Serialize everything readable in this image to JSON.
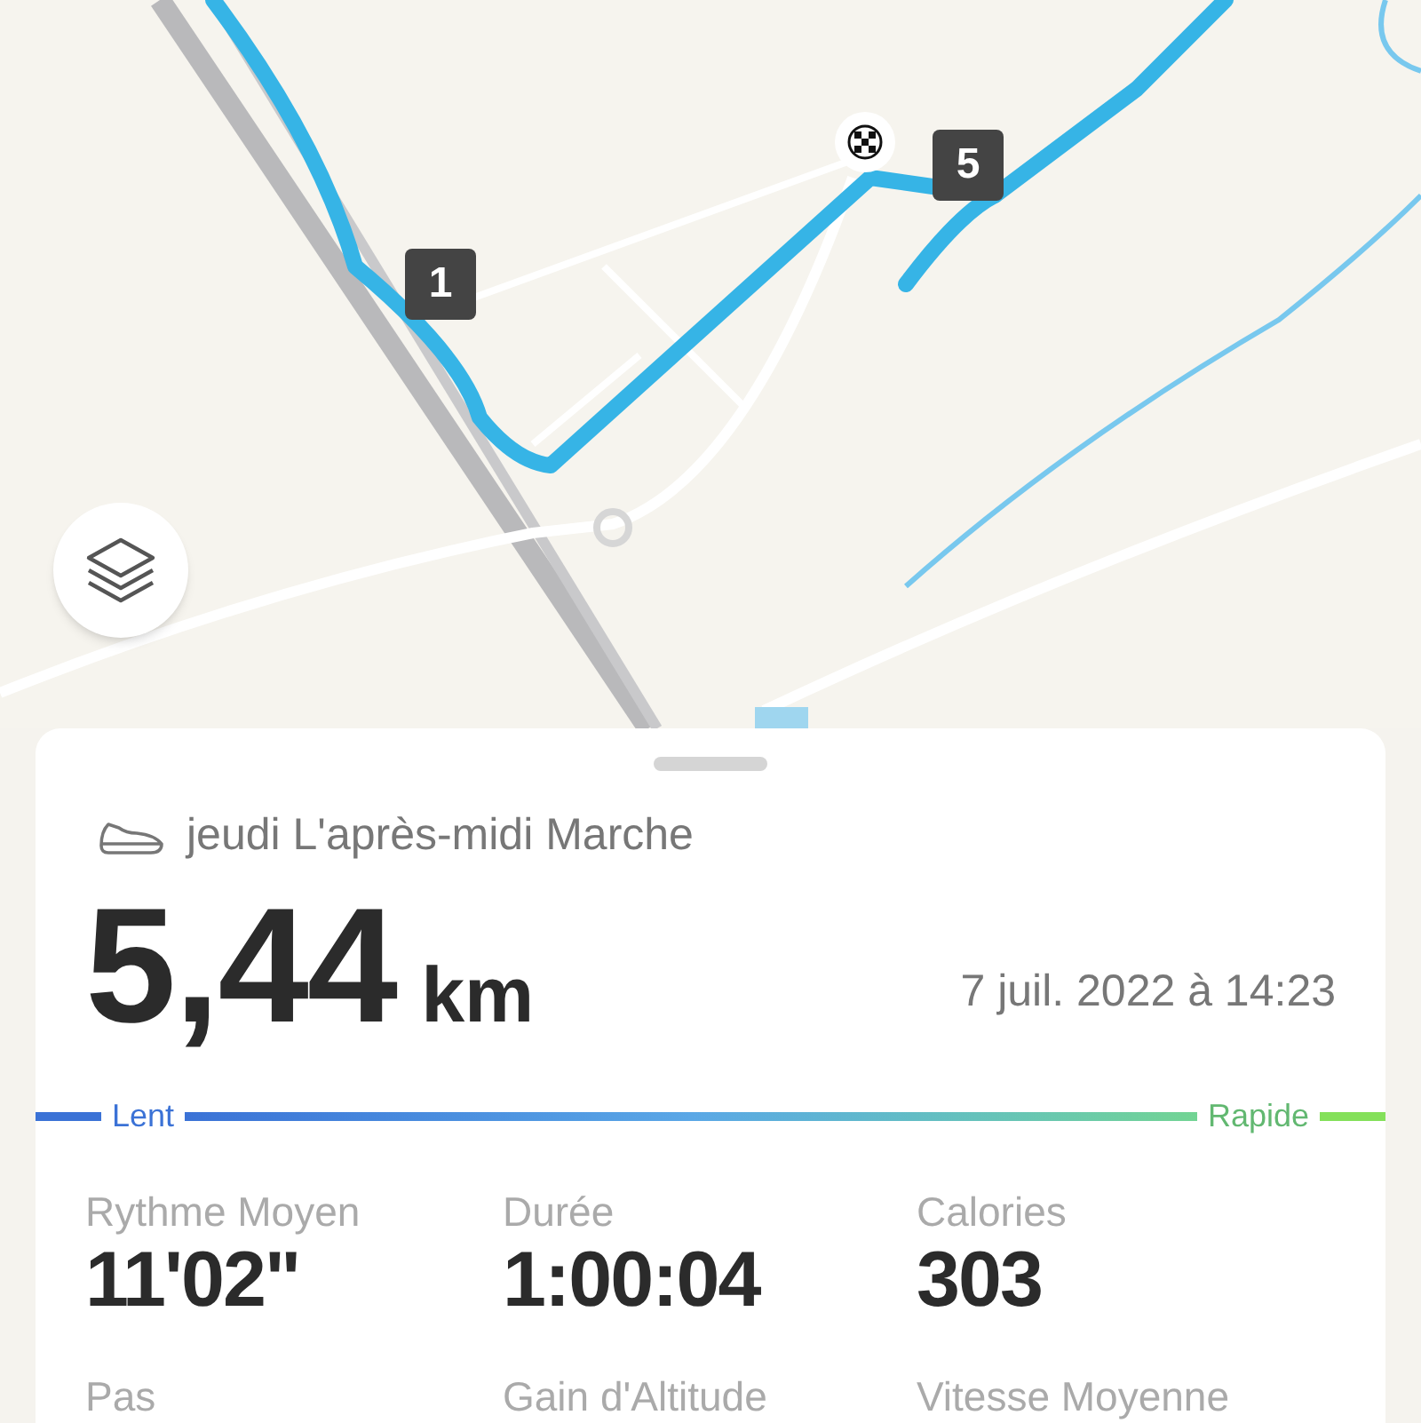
{
  "map": {
    "markers": [
      {
        "label": "1",
        "kind": "km"
      },
      {
        "label": "5",
        "kind": "km"
      },
      {
        "kind": "finish"
      }
    ]
  },
  "activity": {
    "title": "jeudi L'après-midi Marche",
    "distance": "5,44",
    "unit": "km",
    "date": "7 juil. 2022 à 14:23"
  },
  "speed_scale": {
    "slow": "Lent",
    "fast": "Rapide"
  },
  "stats": [
    {
      "label": "Rythme Moyen",
      "value": "11'02\""
    },
    {
      "label": "Durée",
      "value": "1:00:04"
    },
    {
      "label": "Calories",
      "value": "303"
    },
    {
      "label": "Pas"
    },
    {
      "label": "Gain d'Altitude"
    },
    {
      "label": "Vitesse Moyenne"
    }
  ]
}
